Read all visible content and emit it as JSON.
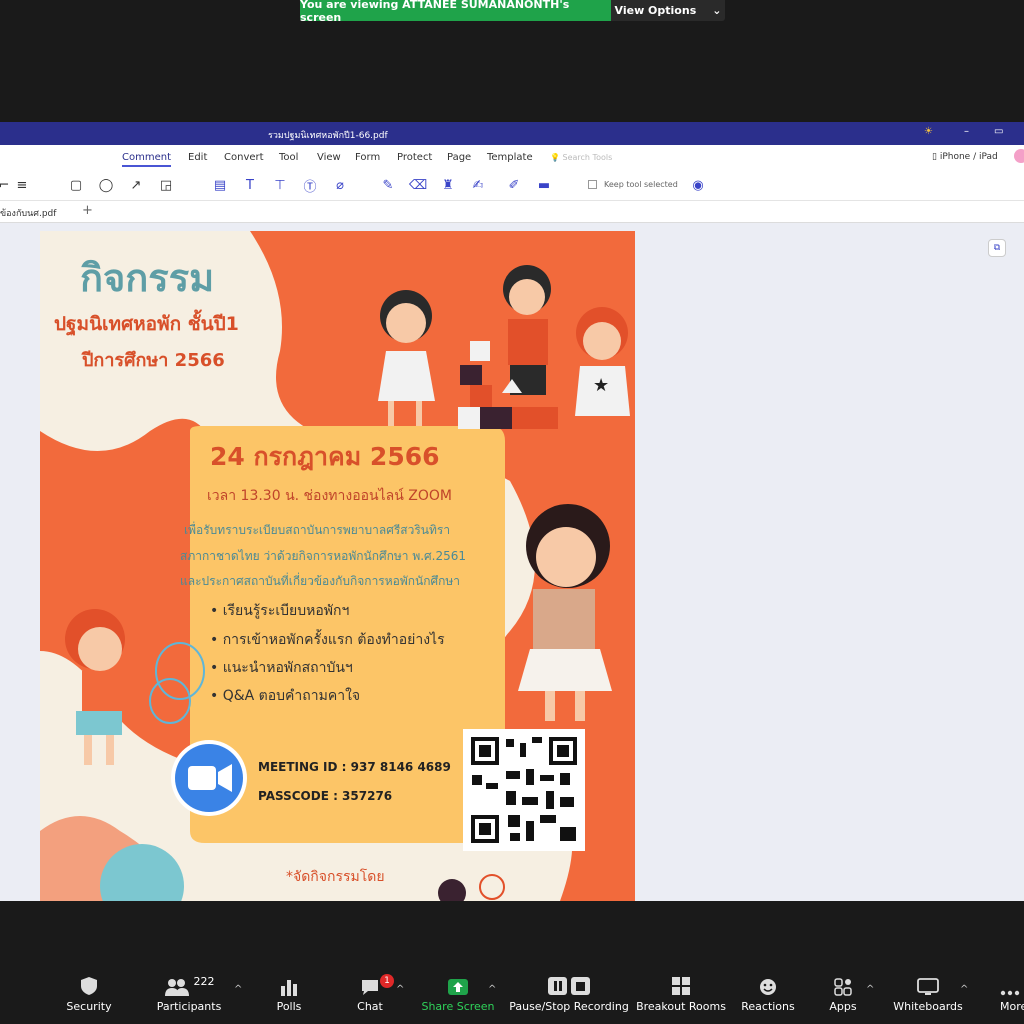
{
  "zoom_banner": {
    "viewing_text": "You are viewing ATTANEE SUMANANONTH's screen",
    "view_options": "View Options"
  },
  "window": {
    "filename": "รวมปฐมนิเทศหอพักปี1-66.pdf"
  },
  "menu": [
    "Comment",
    "Edit",
    "Convert",
    "Tool",
    "View",
    "Form",
    "Protect",
    "Page",
    "Template"
  ],
  "search_placeholder": "Search Tools",
  "device_label": "iPhone / iPad",
  "keep_tool": "Keep tool selected",
  "tab": {
    "name": "ข้องกับนศ.pdf",
    "add": "+"
  },
  "poster": {
    "title": "กิจกรรม",
    "subtitle": "ปฐมนิเทศหอพัก ชั้นปี1",
    "year": "ปีการศึกษา 2566",
    "date": "24 กรกฎาคม 2566",
    "time": "เวลา 13.30 น. ช่องทางออนไลน์ ZOOM",
    "desc1": "เพื่อรับทราบระเบียบสถาบันการพยาบาลศรีสวรินทิรา",
    "desc2": "สภากาชาดไทย ว่าด้วยกิจการหอพักนักศึกษา พ.ศ.2561",
    "desc3": "และประกาศสถาบันที่เกี่ยวข้องกับกิจการหอพักนักศึกษา",
    "bullets": [
      "• เรียนรู้ระเบียบหอพักฯ",
      "• การเข้าหอพักครั้งแรก ต้องทำอย่างไร",
      "• แนะนำหอพักสถาบันฯ",
      "• Q&A ตอบคำถามคาใจ"
    ],
    "meeting_id": "MEETING ID :  937 8146 4689",
    "passcode": "PASSCODE :  357276",
    "organizer": "*จัดกิจกรรมโดย"
  },
  "bottom": {
    "security": "Security",
    "participants": "Participants",
    "participants_count": "222",
    "polls": "Polls",
    "chat": "Chat",
    "chat_badge": "1",
    "share": "Share Screen",
    "recording": "Pause/Stop Recording",
    "breakout": "Breakout Rooms",
    "reactions": "Reactions",
    "apps": "Apps",
    "whiteboards": "Whiteboards",
    "more": "More"
  },
  "colors": {
    "banner_green": "#1fa34a",
    "titlebar": "#2b2f8c",
    "poster_orange": "#f26a3c",
    "poster_yellow": "#fcc567",
    "zoom_blue": "#3a83e6"
  }
}
